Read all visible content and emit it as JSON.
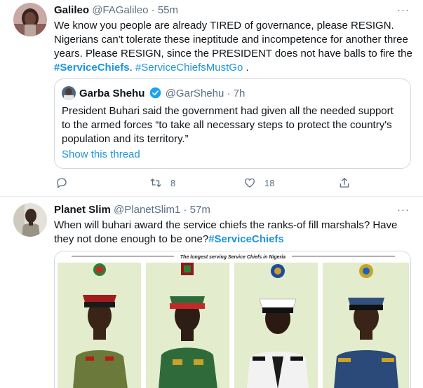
{
  "tweets": [
    {
      "name": "Galileo",
      "handle": "@FAGalileo",
      "separator": "·",
      "time": "55m",
      "more": "···",
      "text_parts": [
        "We know you people are already TIRED of governance, please RESIGN. Nigerians can't tolerate these ineptitude and incompetence for another three years. Please RESIGN, since the PRESIDENT does not have balls to fire the ",
        "#ServiceChiefs",
        ". ",
        "#ServiceChiefsMustGo",
        " ."
      ],
      "quote": {
        "name": "Garba Shehu",
        "handle": "@GarShehu",
        "separator": "·",
        "time": "7h",
        "text": "President Buhari said the government had given all the needed support to the armed forces “to take all necessary steps to protect the country's population and its territory.”",
        "link": "Show this thread"
      },
      "actions": {
        "reply_icon": "reply-icon",
        "retweet_icon": "retweet-icon",
        "retweets": "8",
        "like_icon": "heart-icon",
        "likes": "18",
        "share_icon": "share-icon"
      }
    },
    {
      "name": "Planet Slim",
      "handle": "@PlanetSlim1",
      "separator": "·",
      "time": "57m",
      "more": "···",
      "text_parts": [
        "When will buhari award the service chiefs the ranks-of fill marshals? Have they not done enough to be one?",
        "#ServiceChiefs"
      ],
      "media_caption": "The longest serving Service Chiefs in Nigeria"
    }
  ],
  "colors": {
    "link": "#1b95e0",
    "muted": "#5b7083",
    "border": "#cfd9de",
    "verified": "#1da1f2"
  }
}
